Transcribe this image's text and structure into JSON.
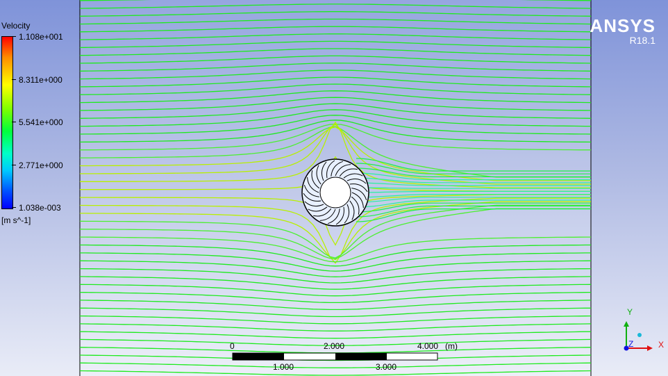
{
  "legend": {
    "title": "Velocity",
    "ticks": [
      "1.108e+001",
      "8.311e+000",
      "5.541e+000",
      "2.771e+000",
      "1.038e-003"
    ],
    "unit": "[m s^-1]"
  },
  "brand": {
    "name": "ANSYS",
    "version": "R18.1"
  },
  "scale_bar": {
    "top_labels": [
      "0",
      "2.000",
      "4.000"
    ],
    "unit": "(m)",
    "bottom_labels": [
      "1.000",
      "3.000"
    ]
  },
  "axes": {
    "y": "Y",
    "z": "Z",
    "x": "X"
  },
  "colors": {
    "streamline": "#1eeb1e",
    "axis_x": "#e01010",
    "axis_y": "#10b010",
    "axis_z": "#1010e0",
    "background_top": "#7f93d9",
    "background_bottom": "#e9ecf7"
  }
}
